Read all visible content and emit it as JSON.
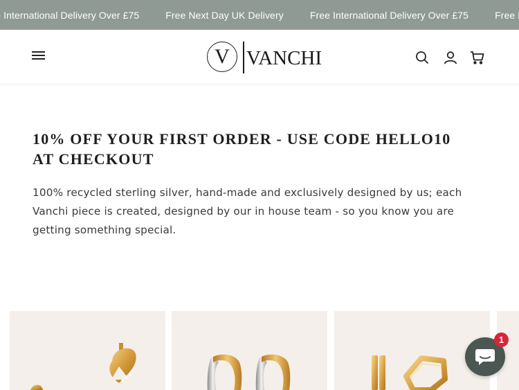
{
  "announcement": {
    "items": [
      "Free International Delivery Over £75",
      "Free Next Day UK Delivery",
      "Free International Delivery Over £75",
      "Free Next Day UK Delivery"
    ]
  },
  "header": {
    "logo_mark": "V",
    "logo_text": "VANCHI",
    "icons": [
      "menu-icon",
      "search-icon",
      "account-icon",
      "cart-icon"
    ]
  },
  "main": {
    "heading": "10% OFF YOUR FIRST ORDER - USE CODE HELLO10 AT CHECKOUT",
    "body": "100% recycled sterling silver, hand-made and exclusively designed by us; each Vanchi piece is created, designed by our in house team - so you know you are getting something special."
  },
  "products": [
    {
      "image": "gold-knot-stud-earrings"
    },
    {
      "image": "two-tone-hoop-earrings"
    },
    {
      "image": "gold-geometric-hoop-earrings"
    },
    {
      "image": "product-image"
    }
  ],
  "chat": {
    "badge_count": "1"
  },
  "colors": {
    "announcement_bg": "#8e9a93",
    "card_bg": "#f4efea",
    "chat_bg": "#4a5753",
    "badge_bg": "#d5263a"
  }
}
